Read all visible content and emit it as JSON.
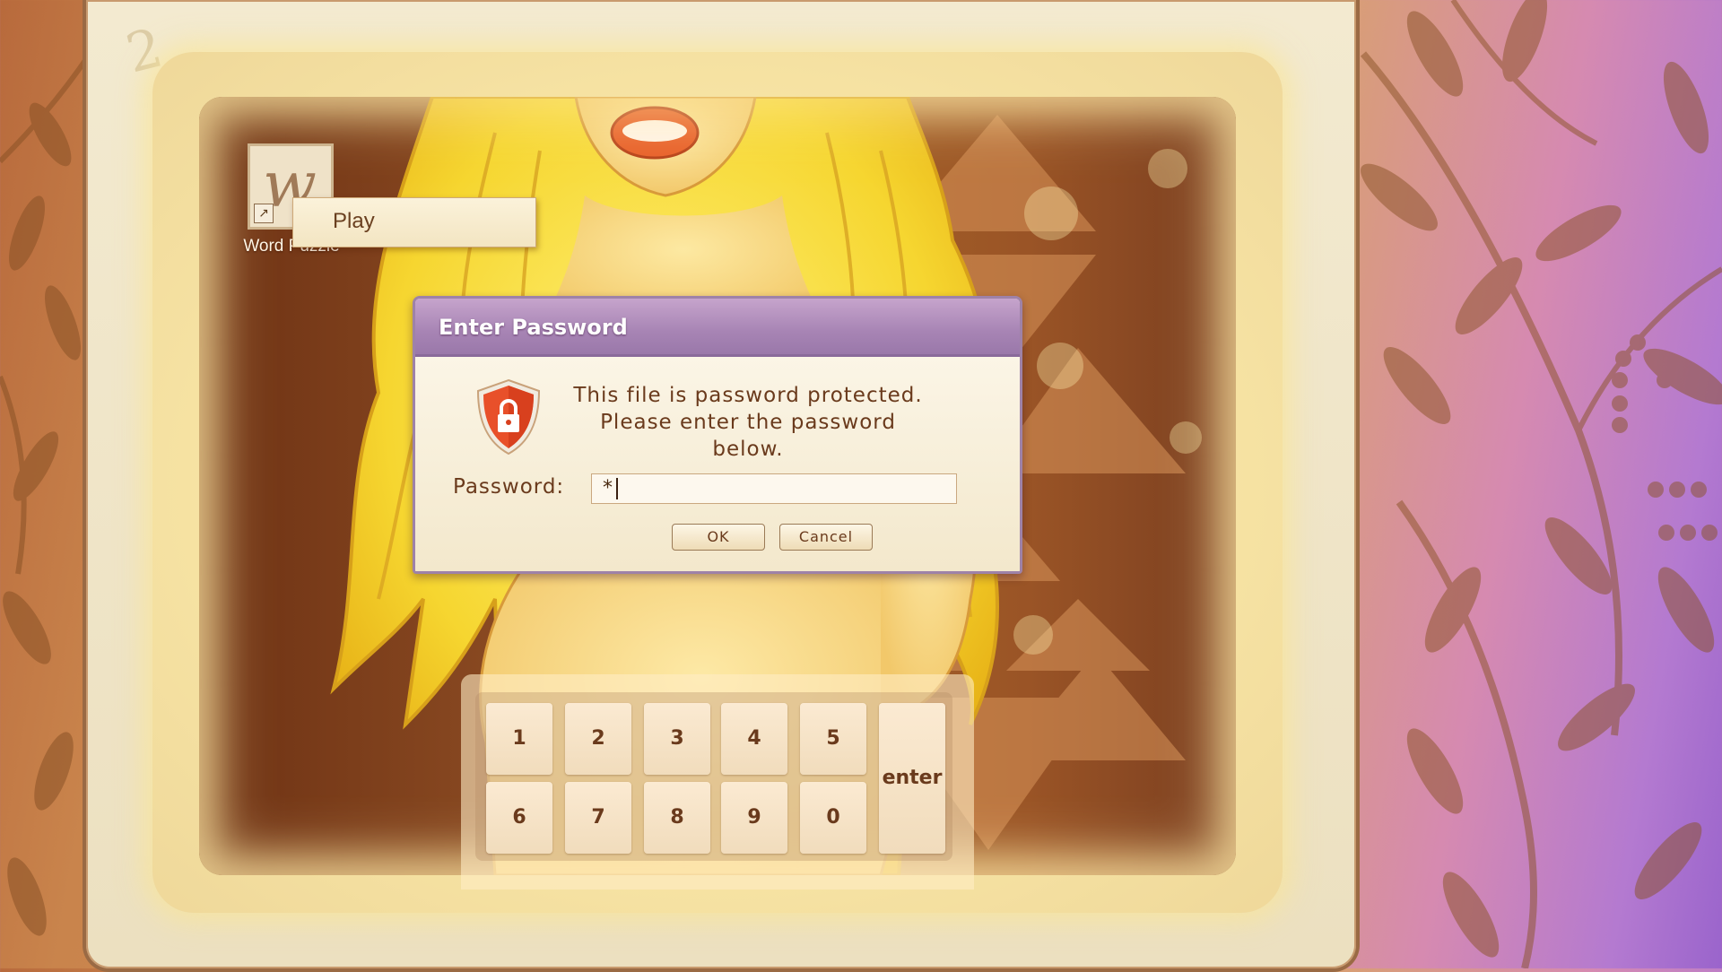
{
  "monitor": {
    "corner_number": "2"
  },
  "desktop": {
    "icon_label": "Word Puzzle",
    "icon_glyph": "w",
    "context_menu": {
      "items": [
        "Play"
      ]
    }
  },
  "dialog": {
    "title": "Enter Password",
    "message_line1": "This file is password protected.",
    "message_line2": "Please enter the password below.",
    "password_label": "Password:",
    "password_value": "*",
    "ok_label": "OK",
    "cancel_label": "Cancel",
    "icon": "shield-lock-icon"
  },
  "keypad": {
    "row1": [
      "1",
      "2",
      "3",
      "4",
      "5"
    ],
    "row2": [
      "6",
      "7",
      "8",
      "9",
      "0"
    ],
    "enter_label": "enter"
  },
  "colors": {
    "dialog_titlebar": "#a784b4",
    "dialog_text": "#6a3a1c",
    "shield": "#e8502a"
  }
}
